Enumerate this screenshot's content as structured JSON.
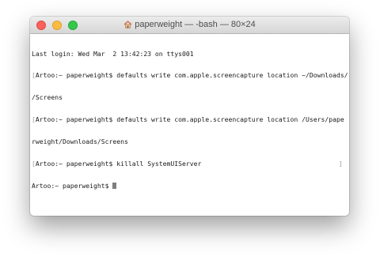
{
  "window": {
    "title": "paperweight — -bash — 80×24",
    "icon": "home-icon"
  },
  "terminal": {
    "lines": [
      {
        "mark": "",
        "text": "Last login: Wed Mar  2 13:42:23 on ttys001"
      },
      {
        "mark": "[",
        "text": "Artoo:~ paperweight$ defaults write com.apple.screencapture location ~/Downloads/"
      },
      {
        "mark": "",
        "text": "/Screens"
      },
      {
        "mark": "[",
        "text": "Artoo:~ paperweight$ defaults write com.apple.screencapture location /Users/pape"
      },
      {
        "mark": "",
        "text": "rweight/Downloads/Screens"
      },
      {
        "mark": "[",
        "text": "Artoo:~ paperweight$ killall SystemUIServer"
      }
    ],
    "end_mark": "]",
    "prompt": "Artoo:~ paperweight$ ",
    "cursor_color": "#7f7f7f"
  },
  "colors": {
    "close": "#fc605c",
    "minimize": "#fdbc40",
    "maximize": "#34c84a"
  }
}
